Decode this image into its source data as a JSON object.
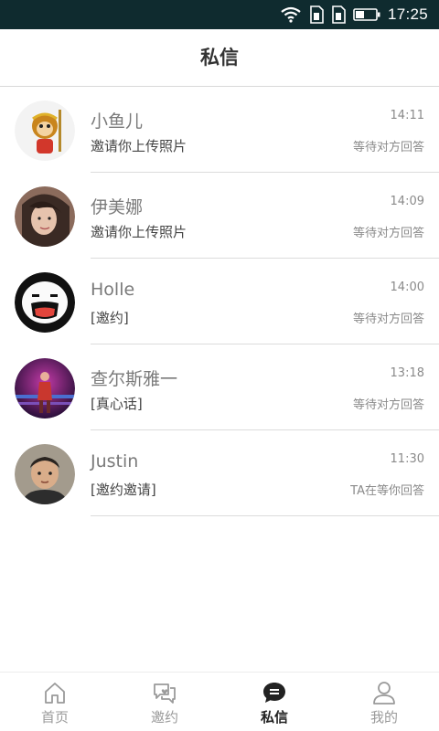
{
  "status_bar": {
    "time": "17:25",
    "icons": [
      "wifi-icon",
      "sim1-icon",
      "sim2-icon",
      "battery-icon"
    ]
  },
  "header": {
    "title": "私信"
  },
  "conversations": [
    {
      "name": "小鱼儿",
      "message": "邀请你上传照片",
      "time": "14:11",
      "status": "等待对方回答",
      "avatar": "monkey-king-avatar"
    },
    {
      "name": "伊美娜",
      "message": "邀请你上传照片",
      "time": "14:09",
      "status": "等待对方回答",
      "avatar": "woman-portrait-avatar"
    },
    {
      "name": "Holle",
      "message": "[邀约]",
      "time": "14:00",
      "status": "等待对方回答",
      "avatar": "cartoon-face-avatar"
    },
    {
      "name": "查尔斯雅一",
      "message": "[真心话]",
      "time": "13:18",
      "status": "等待对方回答",
      "avatar": "stage-performer-avatar"
    },
    {
      "name": "Justin",
      "message": "[邀约邀请]",
      "time": "11:30",
      "status": "TA在等你回答",
      "avatar": "boy-portrait-avatar"
    }
  ],
  "tab_bar": {
    "tabs": [
      {
        "label": "首页",
        "icon": "home-icon",
        "active": false
      },
      {
        "label": "邀约",
        "icon": "invite-chat-icon",
        "active": false
      },
      {
        "label": "私信",
        "icon": "message-bubble-icon",
        "active": true
      },
      {
        "label": "我的",
        "icon": "user-icon",
        "active": false
      }
    ]
  },
  "colors": {
    "status_bar_bg": "#0f2b2f",
    "active_tab": "#222222",
    "inactive_tab": "#9a9a9a"
  }
}
